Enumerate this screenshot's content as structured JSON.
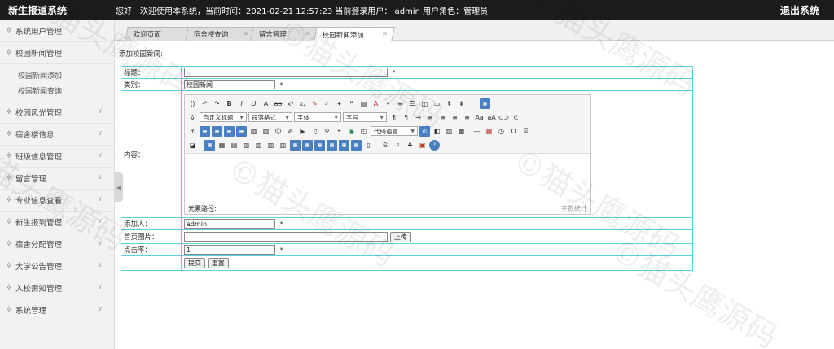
{
  "header": {
    "title": "新生报道系统",
    "welcome": "您好！欢迎使用本系统，当前时间：2021-02-21 12:57:23     当前登录用户： admin  用户角色：管理员",
    "logout": "退出系统"
  },
  "sidebar": {
    "items": [
      {
        "label": "系统用户管理"
      },
      {
        "label": "校园新闻管理"
      },
      {
        "label": "校园风光管理"
      },
      {
        "label": "宿舍楼信息"
      },
      {
        "label": "班级信息管理"
      },
      {
        "label": "留言管理"
      },
      {
        "label": "专业信息查看"
      },
      {
        "label": "新生报到管理"
      },
      {
        "label": "宿舍分配管理"
      },
      {
        "label": "大学公告管理"
      },
      {
        "label": "入校需知管理"
      },
      {
        "label": "系统管理"
      }
    ],
    "subitems": [
      "校园新闻添加",
      "校园新闻查询"
    ]
  },
  "tabs": [
    {
      "label": "欢迎页面"
    },
    {
      "label": "宿舍楼查询"
    },
    {
      "label": "留言管理"
    },
    {
      "label": "校园新闻添加"
    }
  ],
  "form": {
    "section_title": "添加校园新闻:",
    "title_label": "标题：",
    "title_value": "",
    "category_label": "类别：",
    "category_value": "校园新闻",
    "content_label": "内容：",
    "adder_label": "添加人：",
    "adder_value": "admin",
    "image_label": "首页图片：",
    "image_value": "",
    "upload_button": "上传",
    "clicks_label": "点击率：",
    "clicks_value": "1",
    "required_mark": "*",
    "submit_button": "提交",
    "reset_button": "重置"
  },
  "editor": {
    "heading_select": "自定义标题",
    "para_select": "段落格式",
    "font_select": "字体",
    "size_select": "字号",
    "code_select": "代码语言",
    "path_label": "元素路径:",
    "count_label": "字数统计"
  },
  "watermark": "©猫头鹰源码"
}
